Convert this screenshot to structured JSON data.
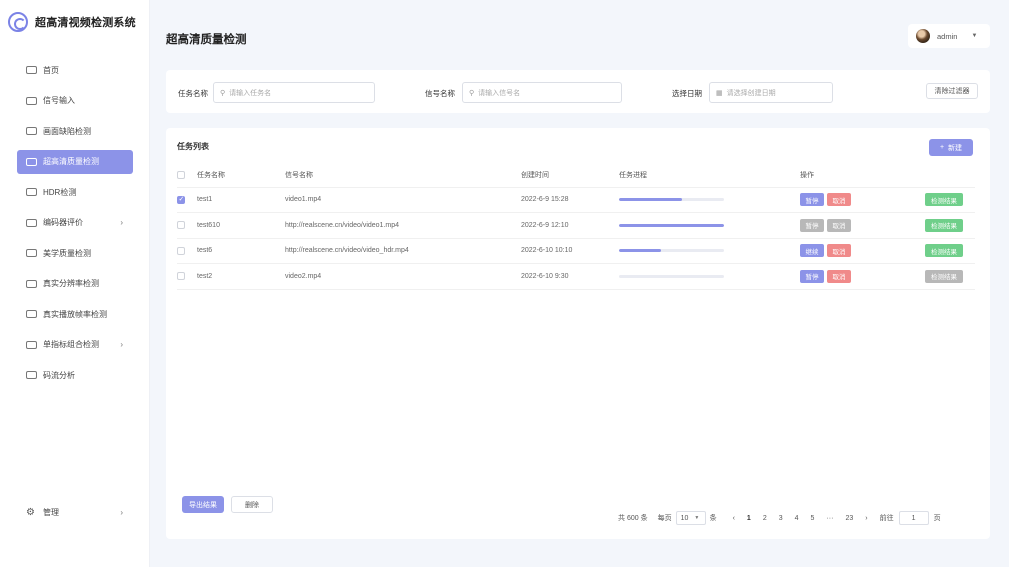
{
  "app": {
    "title": "超高清视频检测系统"
  },
  "sidebar": {
    "items": [
      {
        "label": "首页",
        "icon": "dashboard-icon"
      },
      {
        "label": "信号输入",
        "icon": "signal-icon"
      },
      {
        "label": "画面缺陷检测",
        "icon": "image-icon"
      },
      {
        "label": "超高清质量检测",
        "icon": "monitor-icon",
        "active": true
      },
      {
        "label": "HDR检测",
        "icon": "hdr-icon"
      },
      {
        "label": "编码器评价",
        "icon": "encoder-icon",
        "has_children": true
      },
      {
        "label": "美学质量检测",
        "icon": "aesthetic-icon"
      },
      {
        "label": "真实分辨率检测",
        "icon": "resolution-icon"
      },
      {
        "label": "真实播放帧率检测",
        "icon": "framerate-icon"
      },
      {
        "label": "单指标组合检测",
        "icon": "combo-icon",
        "has_children": true
      },
      {
        "label": "码流分析",
        "icon": "bitstream-icon"
      }
    ],
    "manage_label": "管理"
  },
  "header": {
    "page_title": "超高清质量检测",
    "user": "admin"
  },
  "filter": {
    "task_name_label": "任务名称",
    "task_name_placeholder": "请输入任务名",
    "signal_name_label": "信号名称",
    "signal_name_placeholder": "请输入信号名",
    "date_label": "选择日期",
    "date_placeholder": "请选择创建日期",
    "clear_label": "清除过滤器"
  },
  "tasks": {
    "title": "任务列表",
    "new_label": "新建",
    "columns": [
      "任务名称",
      "信号名称",
      "创建时间",
      "任务进程",
      "操作"
    ],
    "rows": [
      {
        "checked": true,
        "name": "test1",
        "signal": "video1.mp4",
        "created": "2022-6-9 15:28",
        "progress": 0.6,
        "op1": "暂停",
        "op1_style": "blue",
        "op2": "取消",
        "op2_style": "red",
        "result": "检测结果",
        "result_style": "green"
      },
      {
        "checked": false,
        "name": "test610",
        "signal": "http://realscene.cn/video/video1.mp4",
        "created": "2022-6-9 12:10",
        "progress": 1.0,
        "op1": "暂停",
        "op1_style": "gray",
        "op2": "取消",
        "op2_style": "gray",
        "result": "检测结果",
        "result_style": "green"
      },
      {
        "checked": false,
        "name": "test6",
        "signal": "http://realscene.cn/video/video_hdr.mp4",
        "created": "2022-6-10 10:10",
        "progress": 0.4,
        "op1": "继续",
        "op1_style": "blue",
        "op2": "取消",
        "op2_style": "red",
        "result": "检测结果",
        "result_style": "green"
      },
      {
        "checked": false,
        "name": "test2",
        "signal": "video2.mp4",
        "created": "2022-6-10 9:30",
        "progress": 0.0,
        "op1": "暂停",
        "op1_style": "blue",
        "op2": "取消",
        "op2_style": "red",
        "result": "检测结果",
        "result_style": "gray"
      }
    ],
    "export_label": "导出结果",
    "delete_label": "删除"
  },
  "pagination": {
    "total": "共 600 条",
    "per_page_prefix": "每页",
    "per_page": "10",
    "per_page_suffix": "条",
    "pages": [
      "1",
      "2",
      "3",
      "4",
      "5",
      "···",
      "23"
    ],
    "current": "1",
    "goto_prefix": "前往",
    "goto_value": "1",
    "goto_suffix": "页"
  },
  "colors": {
    "accent": "#8c93e8",
    "danger": "#f08a8a",
    "success": "#6fcf8a",
    "disabled": "#b8b8b8"
  }
}
